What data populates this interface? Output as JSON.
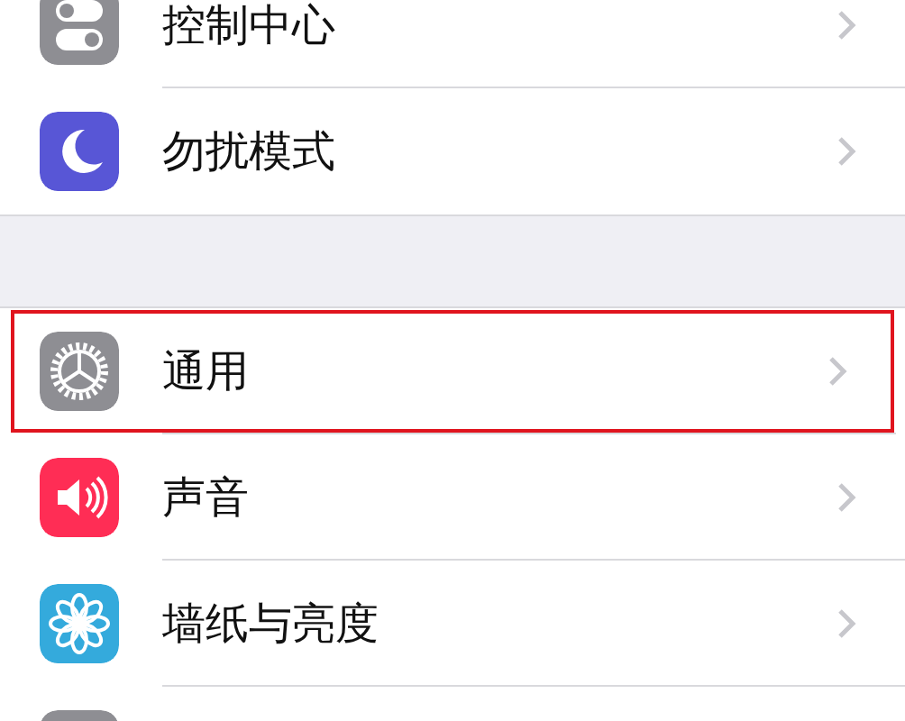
{
  "groups": [
    {
      "items": [
        {
          "kind": "toggles",
          "color": "#8e8e93",
          "label": "控制中心",
          "highlighted": false
        },
        {
          "kind": "moon",
          "color": "#5856d6",
          "label": "勿扰模式",
          "highlighted": false
        }
      ]
    },
    {
      "items": [
        {
          "kind": "gear",
          "color": "#8e8e93",
          "label": "通用",
          "highlighted": true
        },
        {
          "kind": "speaker",
          "color": "#ff2d55",
          "label": "声音",
          "highlighted": false
        },
        {
          "kind": "flower",
          "color": "#34aadc",
          "label": "墙纸与亮度",
          "highlighted": false
        },
        {
          "kind": "blank",
          "color": "#8e8e93",
          "highlighted": false
        }
      ]
    }
  ]
}
